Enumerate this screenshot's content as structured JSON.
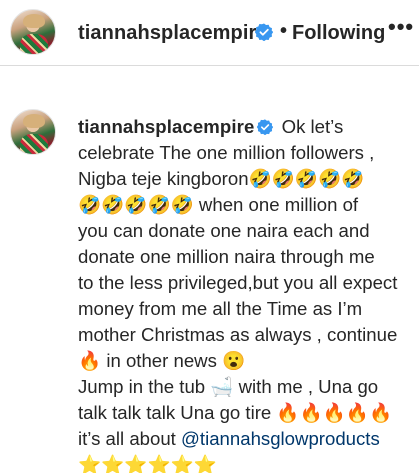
{
  "header": {
    "username": "tiannahsplacempire",
    "separator": "•",
    "follow_label": "Following",
    "more_label": "•••"
  },
  "post": {
    "username": "tiannahsplacempire",
    "lines": [
      "Ok let’s",
      "celebrate The one million followers ,",
      "Nigba teje kingboron🤣🤣🤣🤣🤣",
      "🤣🤣🤣🤣🤣 when one million of",
      "you can donate one naira each and",
      "donate one million naira through me",
      "to the less privileged,but you all expect",
      "money from me all the Time as I’m",
      "mother Christmas as always , continue",
      "🔥 in other news 😮",
      "Jump in the tub 🛁 with me , Una go",
      "talk talk talk Una go tire 🔥🔥🔥🔥🔥",
      "it’s all about "
    ],
    "mention": "@tiannahsglowproducts",
    "final_line": "⭐⭐⭐⭐⭐⭐"
  },
  "colors": {
    "text": "#262626",
    "verified": "#3897f0",
    "mention": "#00376b",
    "divider": "#dbdbdb"
  },
  "icons": {
    "verified": "verified-badge-icon",
    "more": "more-options-icon"
  }
}
